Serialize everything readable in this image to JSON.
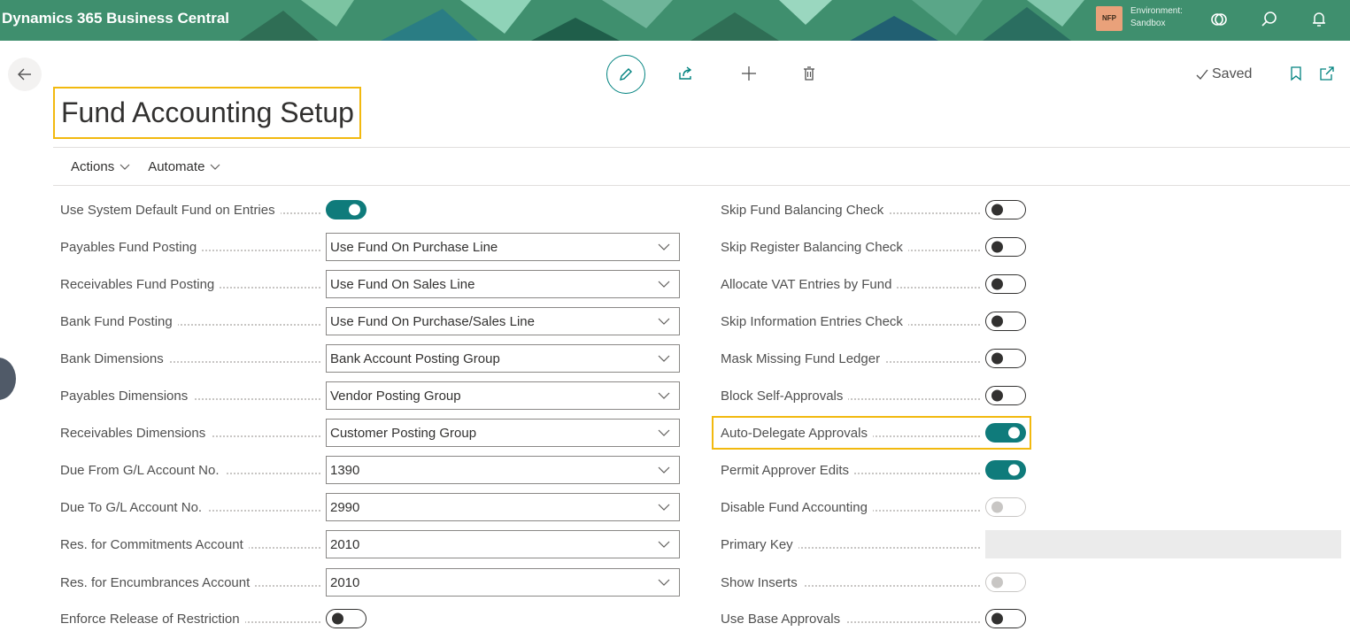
{
  "topbar": {
    "app_title": "Dynamics 365 Business Central",
    "env_badge": "NFP",
    "env_label": "Environment:",
    "env_name": "Sandbox",
    "icons": [
      "copilot-icon",
      "search-icon",
      "bell-icon"
    ]
  },
  "toolbar": {
    "icons": [
      "back-arrow-icon",
      "edit-pencil-icon",
      "share-icon",
      "plus-icon",
      "trash-icon",
      "bookmark-icon",
      "open-new-window-icon"
    ],
    "saved_label": "Saved"
  },
  "page": {
    "title": "Fund Accounting Setup"
  },
  "actionbar": {
    "items": [
      {
        "label": "Actions"
      },
      {
        "label": "Automate"
      }
    ]
  },
  "left_fields": [
    {
      "label": "Use System Default Fund on Entries",
      "type": "toggle",
      "state": "on"
    },
    {
      "label": "Payables Fund Posting",
      "type": "select",
      "value": "Use Fund On Purchase Line"
    },
    {
      "label": "Receivables Fund Posting",
      "type": "select",
      "value": "Use Fund On Sales Line"
    },
    {
      "label": "Bank Fund Posting",
      "type": "select",
      "value": "Use Fund On Purchase/Sales Line"
    },
    {
      "label": "Bank Dimensions",
      "type": "select",
      "value": "Bank Account Posting Group"
    },
    {
      "label": "Payables Dimensions",
      "type": "select",
      "value": "Vendor Posting Group"
    },
    {
      "label": "Receivables Dimensions",
      "type": "select",
      "value": "Customer Posting Group"
    },
    {
      "label": "Due From G/L Account No.",
      "type": "select",
      "value": "1390"
    },
    {
      "label": "Due To G/L Account No.",
      "type": "select",
      "value": "2990"
    },
    {
      "label": "Res. for Commitments Account",
      "type": "select",
      "value": "2010"
    },
    {
      "label": "Res. for Encumbrances Account",
      "type": "select",
      "value": "2010"
    },
    {
      "label": "Enforce Release of Restriction",
      "type": "toggle",
      "state": "off"
    }
  ],
  "right_fields": [
    {
      "label": "Skip Fund Balancing Check",
      "type": "toggle",
      "state": "off"
    },
    {
      "label": "Skip Register Balancing Check",
      "type": "toggle",
      "state": "off"
    },
    {
      "label": "Allocate VAT Entries by Fund",
      "type": "toggle",
      "state": "off"
    },
    {
      "label": "Skip Information Entries Check",
      "type": "toggle",
      "state": "off"
    },
    {
      "label": "Mask Missing Fund Ledger",
      "type": "toggle",
      "state": "off"
    },
    {
      "label": "Block Self-Approvals",
      "type": "toggle",
      "state": "off"
    },
    {
      "label": "Auto-Delegate Approvals",
      "type": "toggle",
      "state": "on"
    },
    {
      "label": "Permit Approver Edits",
      "type": "toggle",
      "state": "on"
    },
    {
      "label": "Disable Fund Accounting",
      "type": "toggle",
      "state": "off-disabled"
    },
    {
      "label": "Primary Key",
      "type": "readonly",
      "value": ""
    },
    {
      "label": "Show Inserts",
      "type": "toggle",
      "state": "off-disabled"
    },
    {
      "label": "Use Base Approvals",
      "type": "toggle",
      "state": "off"
    }
  ],
  "colors": {
    "banner": "#3f8f6e",
    "accent": "#0f7b7b",
    "highlight": "#f2b90f"
  }
}
